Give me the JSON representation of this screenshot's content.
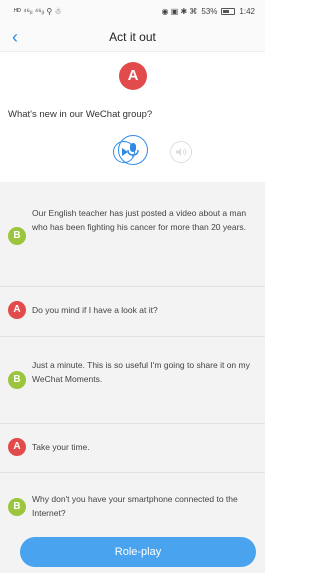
{
  "status_bar": {
    "left": "ᴴᴰ ⁴⁶ᵢₗ ⁴⁶ᵢₗ ⚲ ☃",
    "right_icons": "◉ ▣ ✱ ⌘",
    "battery": "53%",
    "time": "1:42"
  },
  "nav": {
    "back_icon": "‹",
    "title": "Act it out"
  },
  "top": {
    "speaker": "A",
    "question": "What's new in our WeChat group?"
  },
  "dialog": [
    {
      "speaker": "B",
      "text": "Our English teacher has just posted a video about a man who has been fighting his cancer for more than 20 years."
    },
    {
      "speaker": "A",
      "text": "Do you mind if I have a look at it?"
    },
    {
      "speaker": "B",
      "text": "Just a minute. This is so useful I'm going to share it on my WeChat Moments."
    },
    {
      "speaker": "A",
      "text": "Take your time."
    },
    {
      "speaker": "B",
      "text": "Why don't you have your smartphone connected to the Internet?"
    }
  ],
  "actions": {
    "roleplay_label": "Role-play"
  },
  "colors": {
    "accent": "#2f8ae6",
    "speaker_a": "#e24b4b",
    "speaker_b": "#9bc53d",
    "button": "#4aa3ee"
  }
}
